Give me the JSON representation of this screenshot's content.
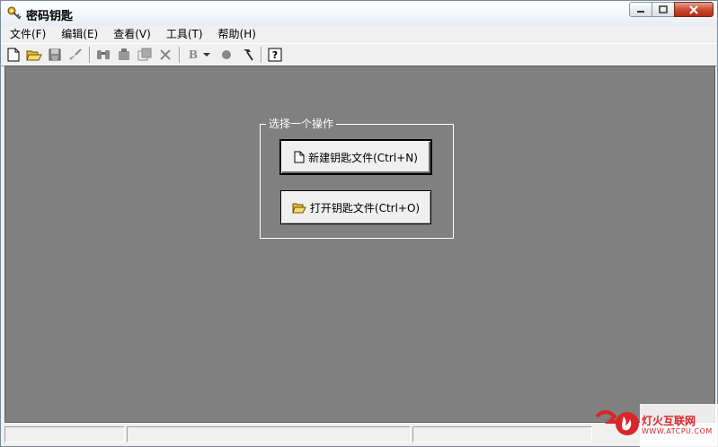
{
  "window": {
    "title": "密码钥匙"
  },
  "menubar": {
    "items": [
      {
        "label": "文件(F)"
      },
      {
        "label": "编辑(E)"
      },
      {
        "label": "查看(V)"
      },
      {
        "label": "工具(T)"
      },
      {
        "label": "帮助(H)"
      }
    ]
  },
  "toolbar": {
    "icons": [
      "new-file-icon",
      "open-folder-icon",
      "save-icon",
      "brush-icon",
      "binoculars-icon",
      "cut-icon",
      "paste-icon",
      "delete-icon",
      "bold-icon",
      "dropdown-arrow-icon",
      "circle-icon",
      "hammer-icon",
      "help-icon"
    ]
  },
  "main": {
    "group_label": "选择一个操作",
    "new_button_label": "新建钥匙文件(Ctrl+N)",
    "open_button_label": "打开钥匙文件(Ctrl+O)"
  },
  "watermark": {
    "text": "灯火互联网",
    "url": "WWW.ATCPU.COM"
  },
  "colors": {
    "workspace": "#808080",
    "window": "#f0f0f0",
    "close_button": "#c9452d",
    "watermark": "#d8262a"
  }
}
